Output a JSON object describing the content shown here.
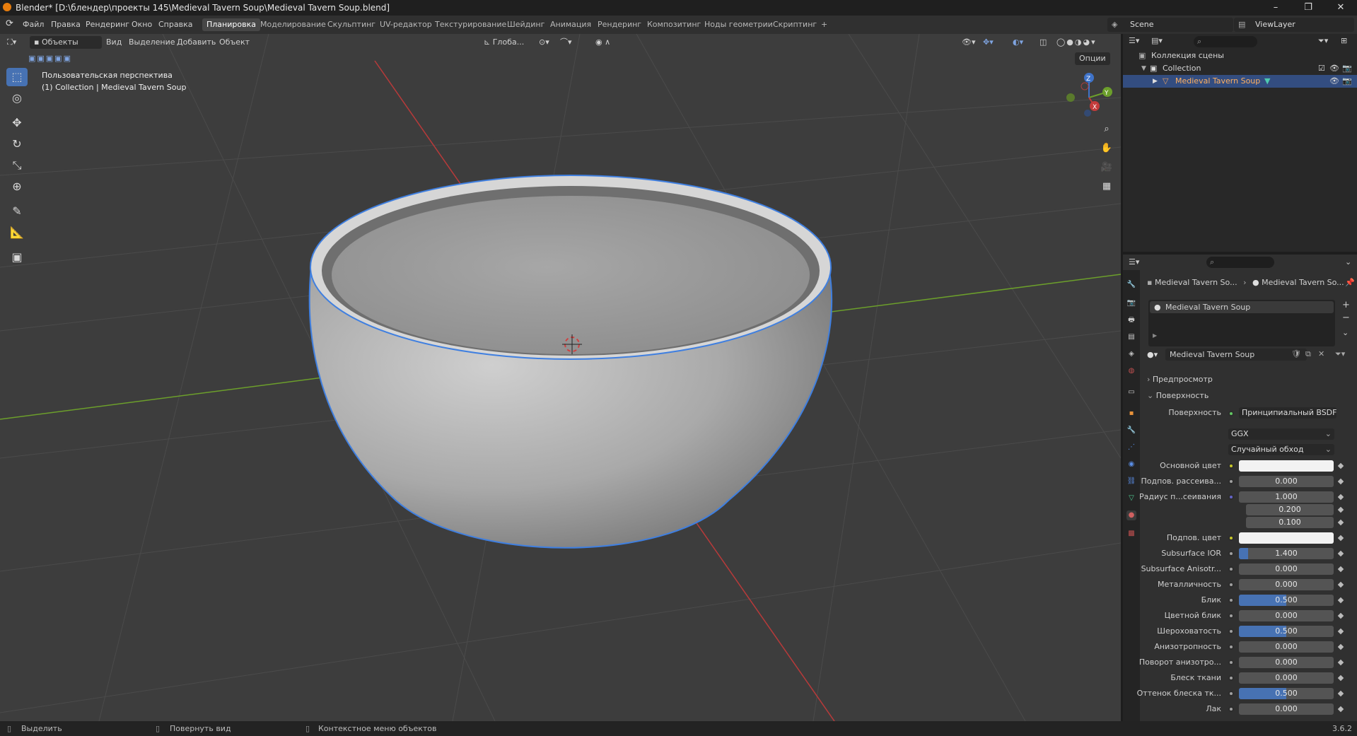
{
  "window": {
    "title": "Blender* [D:\\блендер\\проекты 145\\Medieval Tavern Soup\\Medieval Tavern Soup.blend]",
    "minimize": "–",
    "maximize": "❐",
    "close": "✕"
  },
  "menu": [
    "Файл",
    "Правка",
    "Рендеринг",
    "Окно",
    "Справка"
  ],
  "workspaces": [
    "Планировка",
    "Моделирование",
    "Скульптинг",
    "UV-редактор",
    "Текстурирование",
    "Шейдинг",
    "Анимация",
    "Рендеринг",
    "Композитинг",
    "Ноды геометрии",
    "Скриптинг"
  ],
  "workspace_add": "+",
  "scene": {
    "name": "Scene",
    "view_layer": "ViewLayer"
  },
  "viewport_header": {
    "mode": "Объекты",
    "menus": [
      "Вид",
      "Выделение",
      "Добавить",
      "Объект"
    ],
    "orientation": "Глоба...",
    "options": "Опции"
  },
  "viewport_overlay": {
    "view_name": "Пользовательская перспектива",
    "collection_info": "(1) Collection | Medieval Tavern Soup"
  },
  "gizmo": {
    "x": "X",
    "y": "Y",
    "z": "Z"
  },
  "outliner": {
    "scene_collection": "Коллекция сцены",
    "collection": "Collection",
    "object": "Medieval Tavern Soup"
  },
  "properties": {
    "breadcrumb_object": "Medieval Tavern So...",
    "breadcrumb_material": "Medieval Tavern So...",
    "material_slot": "Medieval Tavern Soup",
    "material_name": "Medieval Tavern Soup",
    "panel_preview": "Предпросмотр",
    "panel_surface": "Поверхность",
    "surface_label": "Поверхность",
    "surface_value": "Принципиальный BSDF",
    "distribution": "GGX",
    "subsurface_method": "Случайный обход",
    "rows": [
      {
        "label": "Основной цвет",
        "type": "color",
        "value": "",
        "color": "#f2f2f2"
      },
      {
        "label": "Подпов. рассеива...",
        "type": "number",
        "value": "0.000",
        "fill": 0
      },
      {
        "label": "Радиус п...сеивания",
        "type": "number",
        "value": "1.000",
        "fill": 0
      },
      {
        "label": "",
        "type": "number",
        "value": "0.200",
        "fill": 0
      },
      {
        "label": "",
        "type": "number",
        "value": "0.100",
        "fill": 0
      },
      {
        "label": "Подпов. цвет",
        "type": "color",
        "value": "",
        "color": "#f2f2f2"
      },
      {
        "label": "Subsurface IOR",
        "type": "number",
        "value": "1.400",
        "fill": 0.1
      },
      {
        "label": "Subsurface Anisotr...",
        "type": "number",
        "value": "0.000",
        "fill": 0
      },
      {
        "label": "Металличность",
        "type": "number",
        "value": "0.000",
        "fill": 0
      },
      {
        "label": "Блик",
        "type": "number",
        "value": "0.500",
        "fill": 0.5
      },
      {
        "label": "Цветной блик",
        "type": "number",
        "value": "0.000",
        "fill": 0
      },
      {
        "label": "Шероховатость",
        "type": "number",
        "value": "0.500",
        "fill": 0.5
      },
      {
        "label": "Анизотропность",
        "type": "number",
        "value": "0.000",
        "fill": 0
      },
      {
        "label": "Поворот анизотро...",
        "type": "number",
        "value": "0.000",
        "fill": 0
      },
      {
        "label": "Блеск ткани",
        "type": "number",
        "value": "0.000",
        "fill": 0
      },
      {
        "label": "Оттенок блеска тк...",
        "type": "number",
        "value": "0.500",
        "fill": 0.5
      },
      {
        "label": "Лак",
        "type": "number",
        "value": "0.000",
        "fill": 0
      }
    ]
  },
  "statusbar": {
    "select": "Выделить",
    "rotate": "Повернуть вид",
    "context_menu": "Контекстное меню объектов",
    "version": "3.6.2"
  }
}
